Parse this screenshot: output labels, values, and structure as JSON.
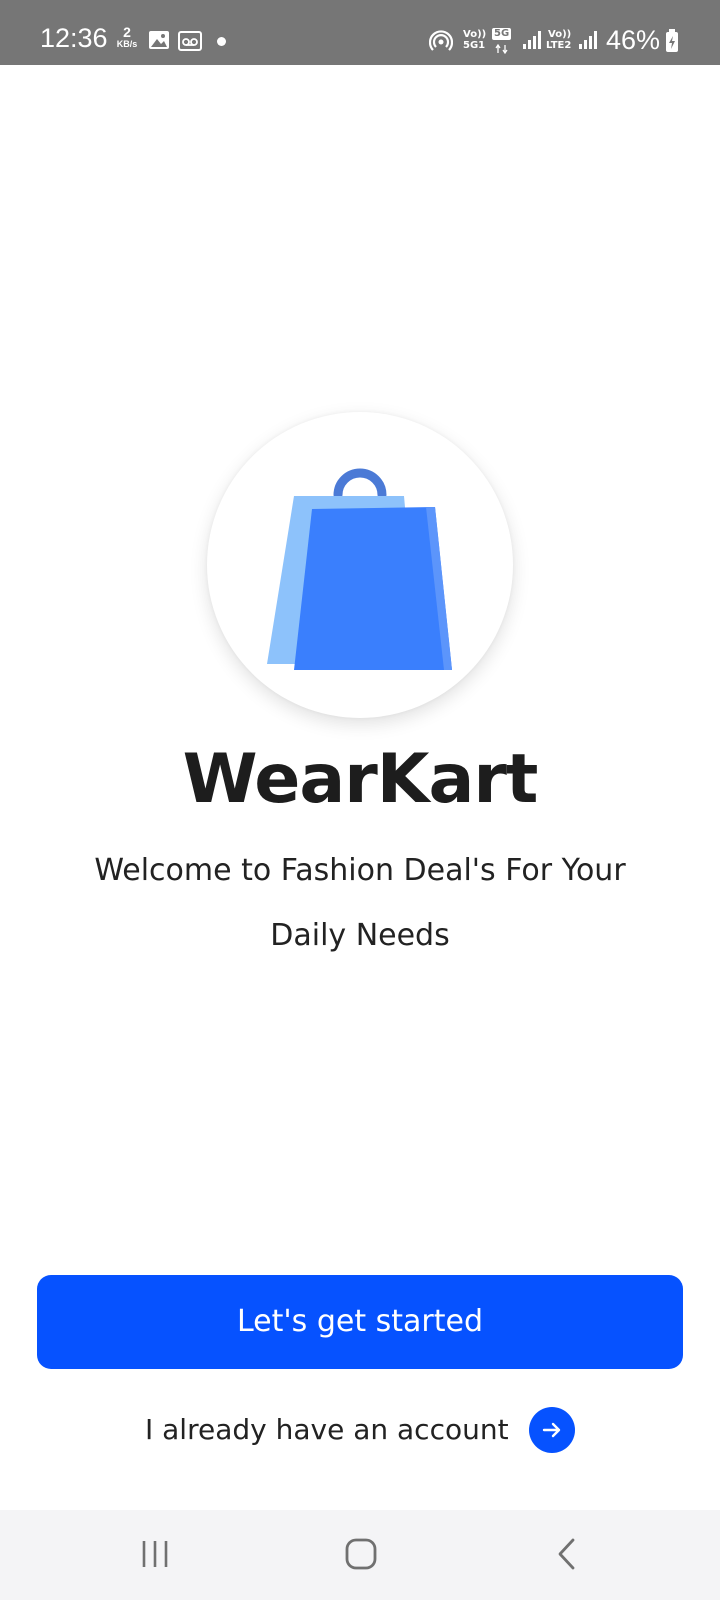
{
  "status_bar": {
    "time": "12:36",
    "net_speed_value": "2",
    "net_speed_unit": "KB/s",
    "sim1_volte": "Vo))",
    "sim1_type": "5G1",
    "sim1_network": "5G",
    "sim2_volte": "Vo))",
    "sim2_type": "LTE2",
    "battery": "46%",
    "icons": [
      "gallery-icon",
      "voicemail-icon",
      "notification-dot-icon",
      "hotspot-icon",
      "signal-icon",
      "signal-icon",
      "battery-charging-icon"
    ]
  },
  "app": {
    "title": "WearKart",
    "welcome": "Welcome to Fashion Deal's For Your Daily Needs",
    "logo_icon": "shopping-bag-icon"
  },
  "actions": {
    "get_started": "Let's get started",
    "have_account": "I already have an account",
    "have_account_icon": "arrow-right-icon"
  },
  "nav_bar": {
    "icons": [
      "recent-apps-icon",
      "home-icon",
      "back-icon"
    ]
  },
  "colors": {
    "primary": "#0652ff",
    "status_bar": "#767676",
    "text": "#1d1d1d",
    "bag_front": "#3a7ffd",
    "bag_back": "#8dc2fb",
    "bag_handle": "#4b7ad6",
    "nav_bar": "#f4f4f6"
  }
}
